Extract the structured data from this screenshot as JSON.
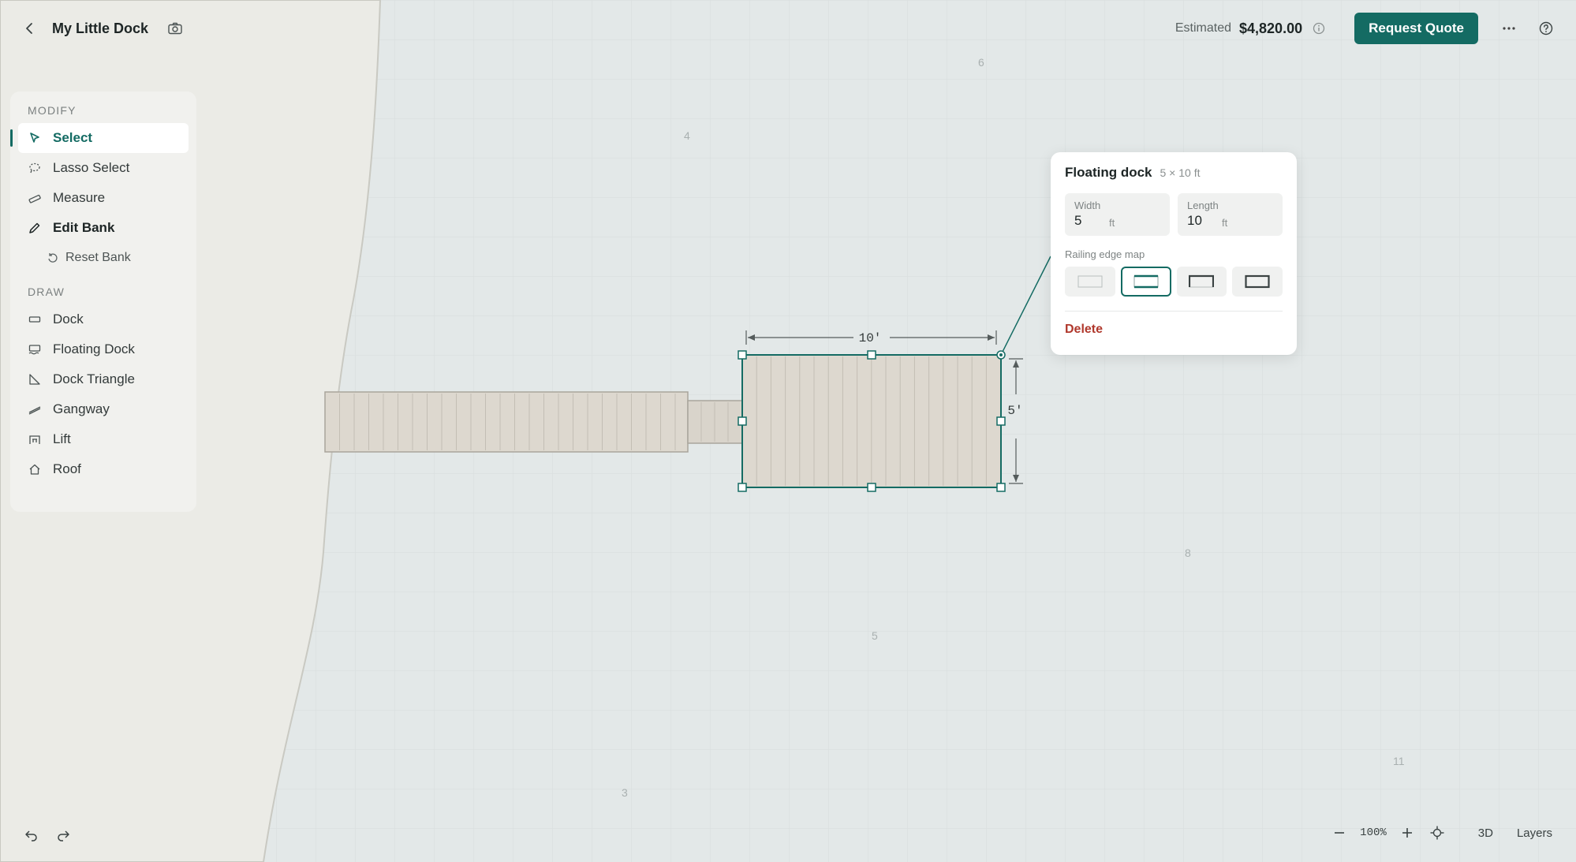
{
  "header": {
    "title": "My Little Dock",
    "estimate_label": "Estimated",
    "estimate_value": "$4,820.00",
    "quote_button": "Request Quote"
  },
  "tools": {
    "modify_header": "MODIFY",
    "draw_header": "DRAW",
    "modify_items": [
      {
        "label": "Select",
        "icon": "cursor-icon",
        "state": "active"
      },
      {
        "label": "Lasso Select",
        "icon": "lasso-icon"
      },
      {
        "label": "Measure",
        "icon": "ruler-icon"
      },
      {
        "label": "Edit Bank",
        "icon": "pen-icon",
        "state": "bold"
      },
      {
        "label": "Reset Bank",
        "icon": "reset-icon",
        "state": "sub"
      }
    ],
    "draw_items": [
      {
        "label": "Dock",
        "icon": "dock-icon"
      },
      {
        "label": "Floating Dock",
        "icon": "floating-dock-icon"
      },
      {
        "label": "Dock Triangle",
        "icon": "triangle-icon"
      },
      {
        "label": "Gangway",
        "icon": "gangway-icon"
      },
      {
        "label": "Lift",
        "icon": "lift-icon"
      },
      {
        "label": "Roof",
        "icon": "roof-icon"
      }
    ]
  },
  "canvas": {
    "grid_labels": [
      "6",
      "4",
      "8",
      "5",
      "3",
      "11"
    ],
    "dimension_length": "10′",
    "dimension_width": "5′"
  },
  "popover": {
    "title": "Floating dock",
    "subtitle": "5 × 10 ft",
    "width_label": "Width",
    "width_value": "5",
    "length_label": "Length",
    "length_value": "10",
    "unit": "ft",
    "railing_label": "Railing edge map",
    "railing_options": [
      "none",
      "top-bottom",
      "three-sides",
      "all-sides"
    ],
    "railing_selected": "top-bottom",
    "delete_label": "Delete"
  },
  "footer": {
    "zoom": "100%",
    "view_3d": "3D",
    "layers": "Layers"
  },
  "colors": {
    "accent": "#146b63",
    "danger": "#b0382c",
    "water": "#e3e8e8",
    "land": "#ebebe6",
    "deck": "#ddd8cf"
  }
}
